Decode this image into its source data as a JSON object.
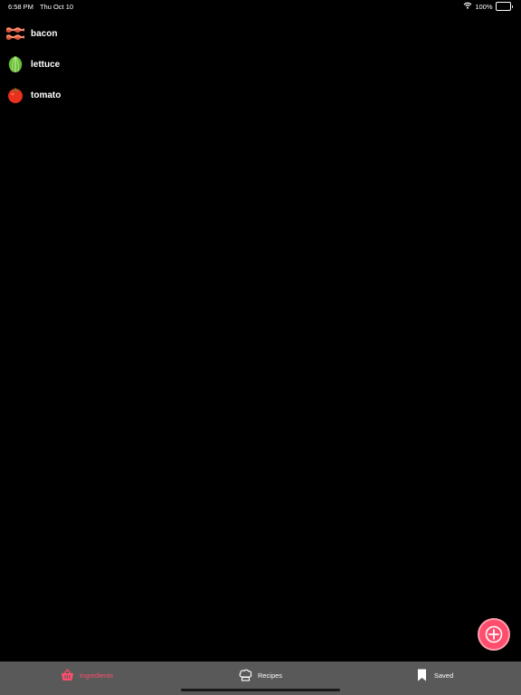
{
  "status_bar": {
    "time": "6:58 PM",
    "date": "Thu Oct 10",
    "battery": "100%",
    "battery_level": 1.0,
    "icons": [
      "wifi-icon",
      "battery-icon"
    ]
  },
  "ingredients": [
    {
      "label": "bacon",
      "icon": "bacon-icon"
    },
    {
      "label": "lettuce",
      "icon": "lettuce-icon"
    },
    {
      "label": "tomato",
      "icon": "tomato-icon"
    }
  ],
  "fab": {
    "icon": "plus-icon",
    "color": "#ff4d6d"
  },
  "tab_bar": {
    "tabs": [
      {
        "label": "Ingredients",
        "icon": "basket-icon",
        "active": true
      },
      {
        "label": "Recipes",
        "icon": "chef-hat-icon",
        "active": false
      },
      {
        "label": "Saved",
        "icon": "bookmark-icon",
        "active": false
      }
    ],
    "background": "#595959",
    "active_color": "#ff4d6d"
  }
}
